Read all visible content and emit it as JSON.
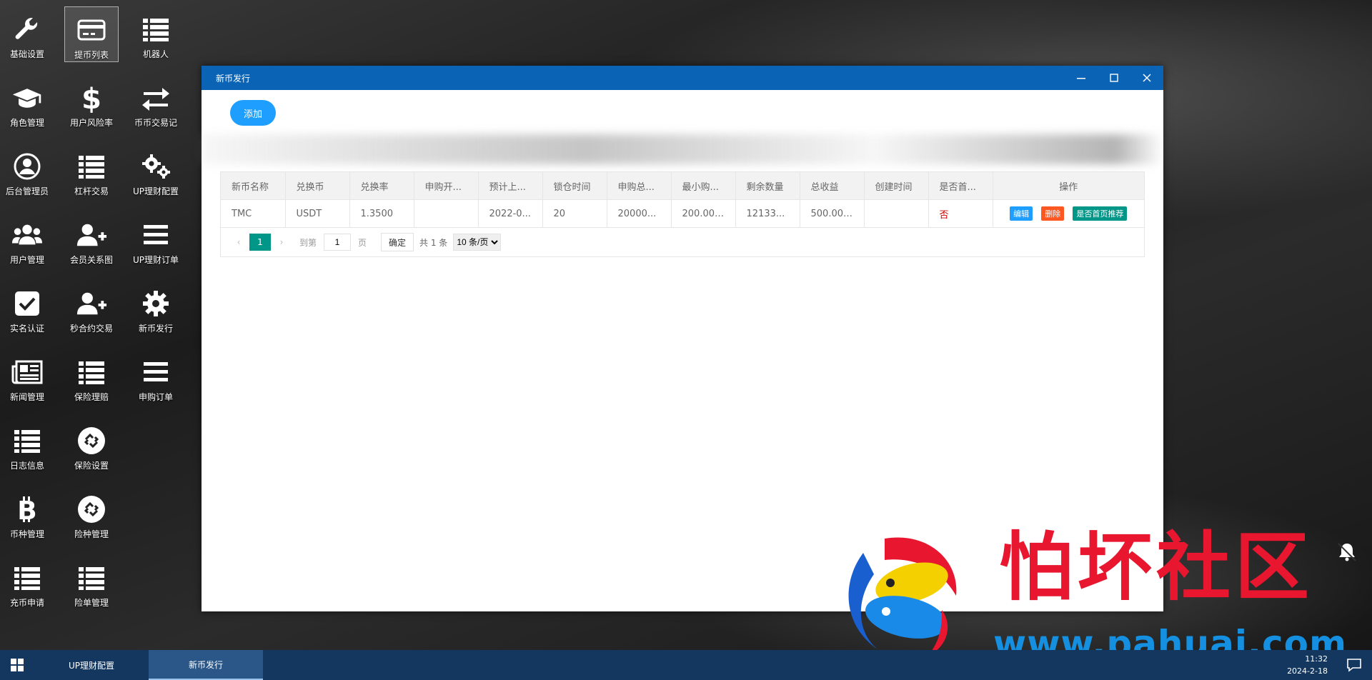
{
  "desktop_icons": [
    {
      "label": "基础设置",
      "icon": "wrench-icon"
    },
    {
      "label": "提币列表",
      "icon": "credit-card-icon",
      "selected": true
    },
    {
      "label": "机器人",
      "icon": "list-icon"
    },
    {
      "label": "角色管理",
      "icon": "graduation-cap-icon"
    },
    {
      "label": "用户风险率",
      "icon": "dollar-icon"
    },
    {
      "label": "币币交易记",
      "icon": "exchange-icon"
    },
    {
      "label": "后台管理员",
      "icon": "user-circle-icon"
    },
    {
      "label": "杠杆交易",
      "icon": "list-icon"
    },
    {
      "label": "UP理财配置",
      "icon": "gears-icon"
    },
    {
      "label": "用户管理",
      "icon": "users-icon"
    },
    {
      "label": "会员关系图",
      "icon": "user-plus-icon"
    },
    {
      "label": "UP理财订单",
      "icon": "bars-icon"
    },
    {
      "label": "实名认证",
      "icon": "check-square-icon"
    },
    {
      "label": "秒合约交易",
      "icon": "user-plus-icon"
    },
    {
      "label": "新币发行",
      "icon": "gear-icon"
    },
    {
      "label": "新闻管理",
      "icon": "newspaper-icon"
    },
    {
      "label": "保险理赔",
      "icon": "list-icon"
    },
    {
      "label": "申购订单",
      "icon": "bars-icon"
    },
    {
      "label": "日志信息",
      "icon": "list-icon"
    },
    {
      "label": "保险设置",
      "icon": "link-circle-icon"
    },
    {
      "label": "币种管理",
      "icon": "bitcoin-icon"
    },
    {
      "label": "险种管理",
      "icon": "link-circle-icon"
    },
    {
      "label": "充币申请",
      "icon": "list-icon"
    },
    {
      "label": "险单管理",
      "icon": "list-icon"
    }
  ],
  "window": {
    "title": "新币发行",
    "add_label": "添加",
    "table": {
      "headers": [
        "新币名称",
        "兑换币",
        "兑换率",
        "申购开...",
        "预计上...",
        "锁仓时间",
        "申购总...",
        "最小购...",
        "剩余数量",
        "总收益",
        "创建时间",
        "是否首...",
        "操作"
      ],
      "rows": [
        {
          "cells": [
            "TMC",
            "USDT",
            "1.3500",
            "",
            "2022-0...",
            "20",
            "20000...",
            "200.0000",
            "12133...",
            "500.0000",
            "",
            "否"
          ],
          "actions": [
            "编辑",
            "删除",
            "是否首页推荐"
          ]
        }
      ]
    },
    "pager": {
      "current": "1",
      "goto_label": "到第",
      "page_value": "1",
      "page_label": "页",
      "confirm": "确定",
      "total": "共 1 条",
      "per_page": "10 条/页"
    }
  },
  "watermark": {
    "title": "怕坏社区",
    "url": "www.pahuai.com"
  },
  "taskbar": {
    "tasks": [
      "UP理财配置",
      "新币发行"
    ],
    "time": "11:32",
    "date": "2024-2-18"
  },
  "colors": {
    "titlebar": "#0b63b6",
    "primary_button": "#1e9fff",
    "pager_active": "#009688",
    "delete": "#ff5722",
    "taskbar": "#13375e",
    "watermark_red": "#e8162e",
    "watermark_blue": "#1590e0"
  }
}
